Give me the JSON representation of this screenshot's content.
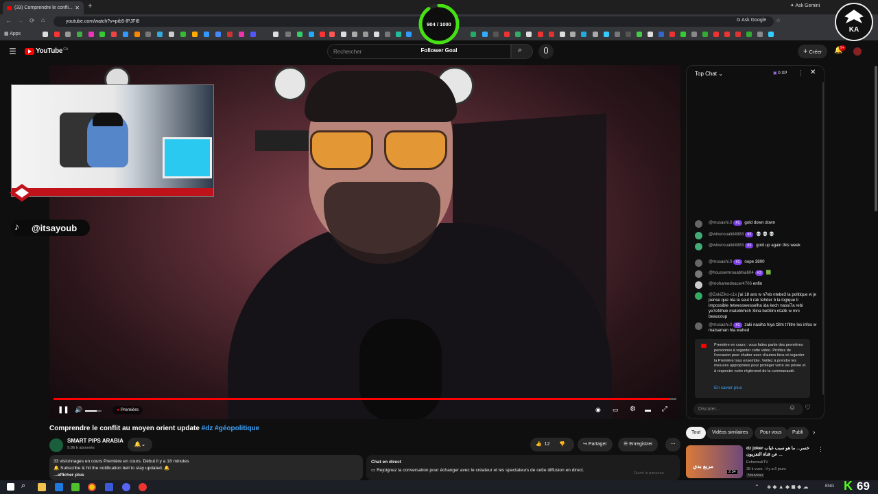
{
  "browser": {
    "tab_title": "(33) Comprendre le confli...",
    "url": "youtube.com/watch?v=pib5-lPJFI8",
    "apps_label": "Apps",
    "ask_google": "Ask Google",
    "ask_gemini": "Ask Gemini"
  },
  "overlay": {
    "follower_count": "904 / 1000",
    "follower_goal": "Follower Goal",
    "tiktok_handle": "@itsayoub",
    "logo_text": "KA"
  },
  "youtube": {
    "logo": "YouTube",
    "region": "CA",
    "search_placeholder": "Rechercher",
    "create_label": "Créer",
    "notif_count": "9+"
  },
  "player": {
    "premiere_label": "Première",
    "progress": 0.99,
    "volume": 0.7
  },
  "video": {
    "title": "Comprendre le conflit au moyen orient update",
    "hashtags": "#dz #géopolitique",
    "channel_name": "SMART PIPS ARABIA",
    "subscribers": "9,86 k abonnés",
    "likes": "12",
    "share_label": "Partager",
    "save_label": "Enregistrer",
    "description_line1": "33 visionnages en cours  Première en cours. Début il y a 18 minutes",
    "description_line2": "🔔 Subscribe & hit the notification bell to stay updated. 🔔",
    "description_more": "...afficher plus",
    "chat_title": "Chat en direct",
    "chat_invite": "Rejoignez la conversation pour échanger avec le créateur et les spectateurs de cette diffusion en direct.",
    "open_panel": "Ouvrir le panneau"
  },
  "chat": {
    "header": "Top Chat",
    "xp": "0 XP",
    "messages": [
      {
        "user": "@musashi.0",
        "badge": "#1",
        "text": "gold down down",
        "color": "#666"
      },
      {
        "user": "@wineroualid4983",
        "badge": "#2",
        "text": "💀 💀 💀",
        "color": "#4a7"
      },
      {
        "user": "@wineroualid4983",
        "badge": "#2",
        "text": "gold up again this week",
        "color": "#4a7"
      },
      {
        "user": "@musashi.0",
        "badge": "#1",
        "text": "nope 3800",
        "color": "#666"
      },
      {
        "user": "@houssemrouabhia604",
        "badge": "#3",
        "text": "🟩",
        "color": "#777"
      },
      {
        "user": "@mohamednacer4706",
        "badge": "",
        "text": "enfin",
        "color": "#ccc"
      },
      {
        "user": "@ZakiZiko-c1x",
        "badge": "",
        "text": "j'ai 18 ans w n7eb ntebe3 la politique w je pense que nta le seul li rak tehder b la logique li impossible tetwesswesselha ida kech nassi7a rebi ye7efdhek matebkhich 3lina bel3ilm nta3k w mrc beaucoup",
        "color": "#3a6"
      },
      {
        "user": "@musashi.0",
        "badge": "#1",
        "text": "zaki nasiha hiya t3lm t filtre les infos w matsaman hta wahed",
        "color": "#666"
      }
    ],
    "notice": "Première en cours : vous faites partie des premières personnes à regarder cette vidéo. Profitez de l'occasion pour chatter avec d'autres fans et regarder la Première tous ensemble. Veillez à prendre les mesures appropriées pour protéger votre vie privée et à respecter notre règlement de la communauté.",
    "learn_more": "En savoir plus",
    "input_placeholder": "Discuter..."
  },
  "sidebar": {
    "chips": [
      "Tout",
      "Vidéos similaires",
      "Pour vous",
      "Publi"
    ],
    "rec": {
      "title": "dz joker خسر... ما هو سبب غياب عن قناة التفزيون ...",
      "channel": "EchoroukTV",
      "stats": "38 k vues · il y a 6 jours",
      "badge": "Nouveau",
      "duration": "2:34",
      "thumb_text": "مربع بدي"
    }
  },
  "taskbar": {
    "lang": "ENG",
    "counter": "69"
  }
}
